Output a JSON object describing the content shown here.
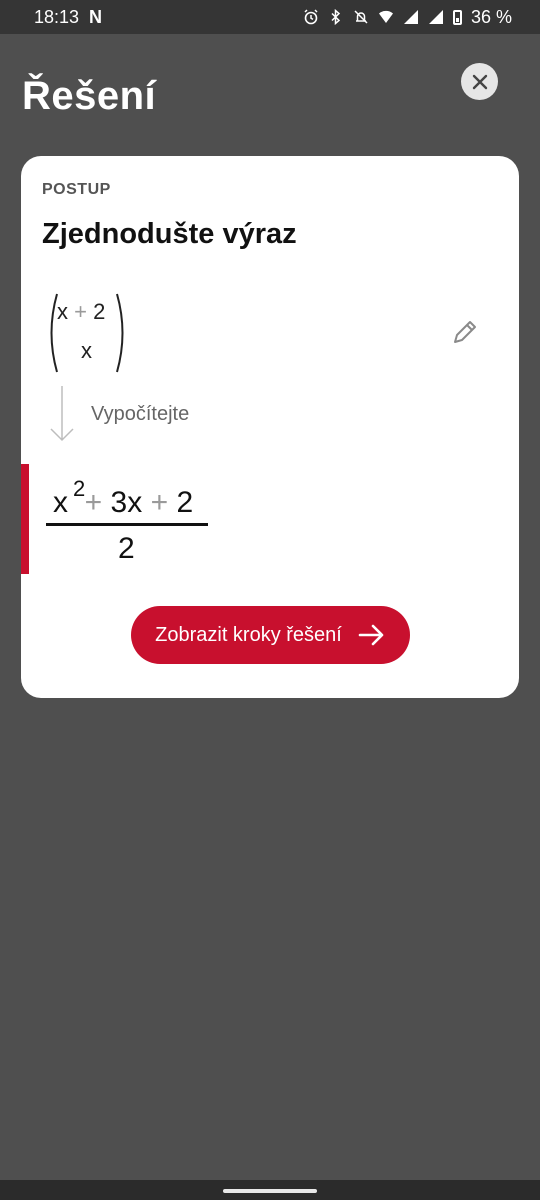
{
  "status_bar": {
    "time": "18:13",
    "app_icon": "netflix-icon",
    "battery": "36 %",
    "icons": [
      "alarm-icon",
      "bluetooth-icon",
      "mute-icon",
      "wifi-icon",
      "signal-icon",
      "signal-icon",
      "battery-icon"
    ]
  },
  "header": {
    "title": "Řešení",
    "close_icon": "close-icon"
  },
  "card": {
    "eyebrow": "POSTUP",
    "title": "Zjednodušte výraz",
    "expression": {
      "top_var": "x",
      "top_op": "+",
      "top_const": "2",
      "bottom": "x"
    },
    "edit_icon": "pencil-icon",
    "step_label": "Vypočítejte",
    "result": {
      "t1": "x",
      "exp": "2",
      "op1": "+",
      "t2": "3x",
      "op2": "+",
      "t3": "2",
      "denominator": "2"
    },
    "cta_label": "Zobrazit kroky řešení",
    "cta_icon": "arrow-right-icon",
    "accent_color": "#c8102e"
  }
}
